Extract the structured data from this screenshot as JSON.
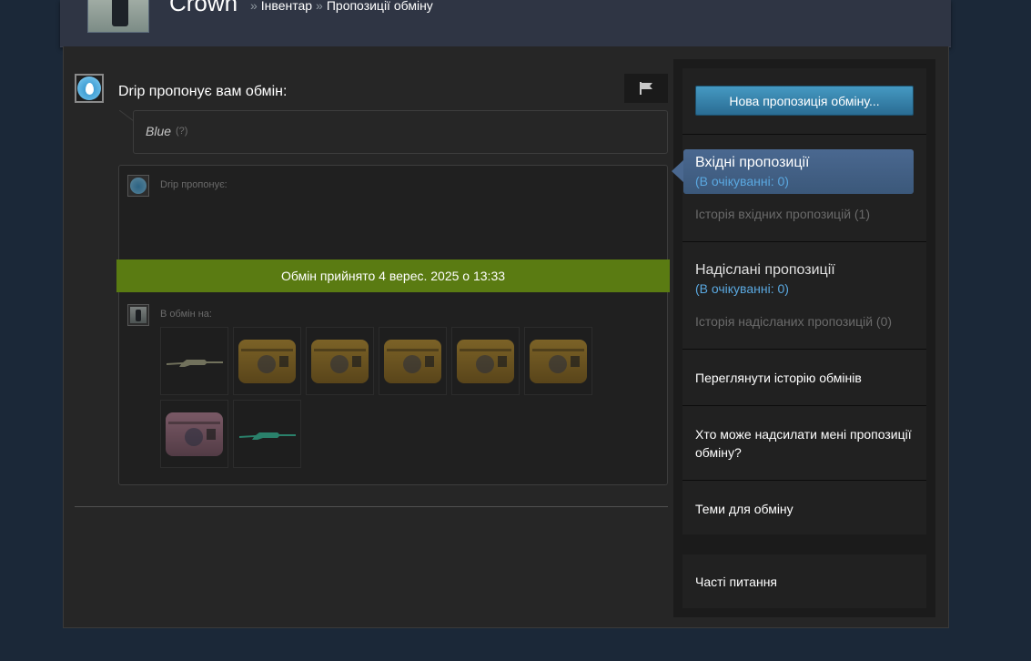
{
  "header": {
    "username": "Crown",
    "breadcrumb_sep": "»",
    "breadcrumb_inventory": "Інвентар",
    "breadcrumb_offers": "Пропозиції обміну"
  },
  "offer": {
    "title": "Drip пропонує вам обмін:",
    "message": "Blue",
    "message_hint": "(?)",
    "partner_label": "Drip пропонує:",
    "accepted_text": "Обмін прийнято 4 верес. 2025 о 13:33",
    "your_label": "В обмін на:",
    "items": [
      {
        "kind": "rifle",
        "color": "#9a9a7a"
      },
      {
        "kind": "case",
        "color": "gold"
      },
      {
        "kind": "case",
        "color": "gold"
      },
      {
        "kind": "case",
        "color": "gold"
      },
      {
        "kind": "case",
        "color": "gold"
      },
      {
        "kind": "case",
        "color": "gold"
      },
      {
        "kind": "case",
        "color": "pink"
      },
      {
        "kind": "rifle",
        "color": "#3bb08a"
      }
    ]
  },
  "sidebar": {
    "new_offer_label": "Нова пропозиція обміну...",
    "incoming_title": "Вхідні пропозиції",
    "incoming_pending": "(В очікуванні: 0)",
    "incoming_history": "Історія вхідних пропозицій (1)",
    "sent_title": "Надіслані пропозиції",
    "sent_pending": "(В очікуванні: 0)",
    "sent_history": "Історія надісланих пропозицій (0)",
    "view_history": "Переглянути історію обмінів",
    "who_can_send": "Хто може надсилати мені пропозиції обміну?",
    "trade_topics": "Теми для обміну",
    "faq": "Часті питання"
  },
  "colors": {
    "accepted_banner": "#5a7b12",
    "active_tab": "#4a6890",
    "pending_link": "#5aa8e0",
    "button": "#4599c2"
  }
}
